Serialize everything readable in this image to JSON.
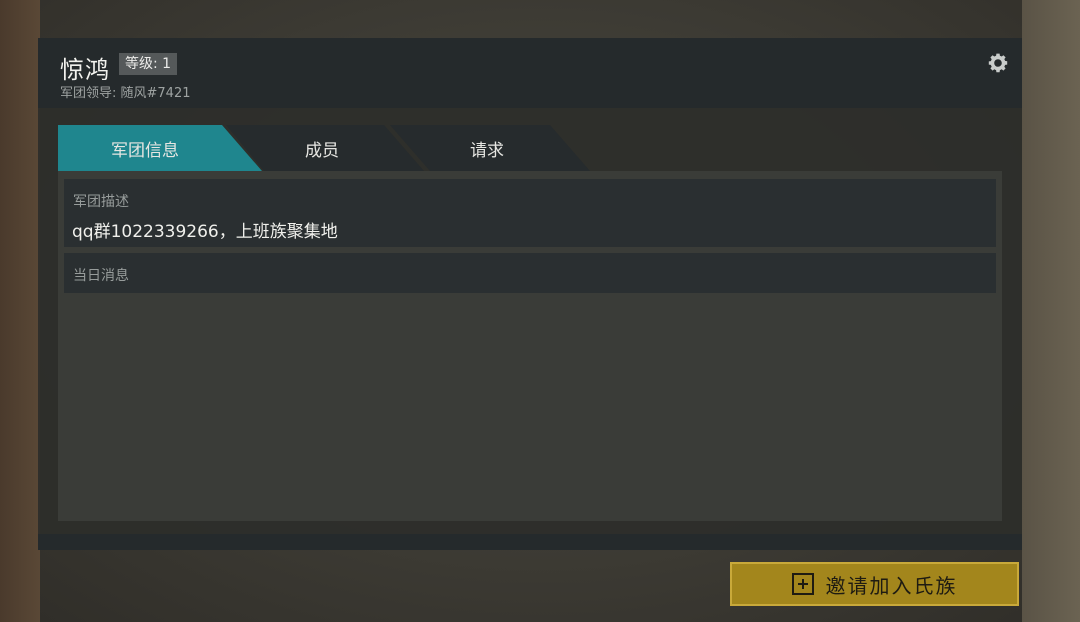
{
  "header": {
    "clan_name": "惊鸿",
    "level_badge": "等级: 1",
    "leader_text": "军团领导: 随风#7421",
    "settings_icon": "gear-icon"
  },
  "tabs": [
    {
      "label": "军团信息",
      "active": true
    },
    {
      "label": "成员",
      "active": false
    },
    {
      "label": "请求",
      "active": false
    }
  ],
  "info": {
    "description_label": "军团描述",
    "description_value": "qq群1022339266，上班族聚集地",
    "motd_label": "当日消息"
  },
  "footer": {
    "invite_label": "邀请加入氏族",
    "invite_icon": "plus-square-icon"
  },
  "colors": {
    "active_tab": "#1f868e",
    "inactive_tab": "#262b2d",
    "invite_button": "#a3861c"
  }
}
